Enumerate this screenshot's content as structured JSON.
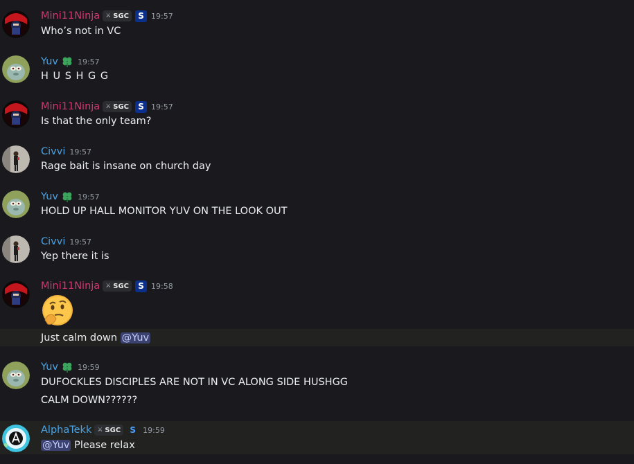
{
  "users": {
    "mini": "Mini11Ninja",
    "yuv": "Yuv",
    "civvi": "Civvi",
    "alpha": "AlphaTekk"
  },
  "tags": {
    "sgc": "SGC"
  },
  "badge_letter": "S",
  "messages": [
    {
      "time": "19:57",
      "text": "Who’s not in VC"
    },
    {
      "time": "19:57",
      "text": "H U S H G G"
    },
    {
      "time": "19:57",
      "text": "Is that the only team?"
    },
    {
      "time": "19:57",
      "text": "Rage bait is insane on church day"
    },
    {
      "time": "19:57",
      "text": "HOLD UP HALL MONITOR YUV ON THE LOOK OUT"
    },
    {
      "time": "19:57",
      "text": "Yep there it is"
    },
    {
      "time": "19:58",
      "text": "Just calm down",
      "mention": "@Yuv",
      "emoji": "thinking-face"
    },
    {
      "time": "19:59",
      "text": "DUFOCKLES DISCIPLES ARE NOT IN VC ALONG SIDE HUSHGG",
      "text2": "CALM DOWN??????"
    },
    {
      "time": "19:59",
      "mention": "@Yuv",
      "text": "Please relax"
    }
  ],
  "colors": {
    "background": "#1a1a1e",
    "mini_name": "#d6366f",
    "blue_name": "#4ba3e3",
    "mention_bg": "#3c4270",
    "highlight_bg": "#222220"
  }
}
